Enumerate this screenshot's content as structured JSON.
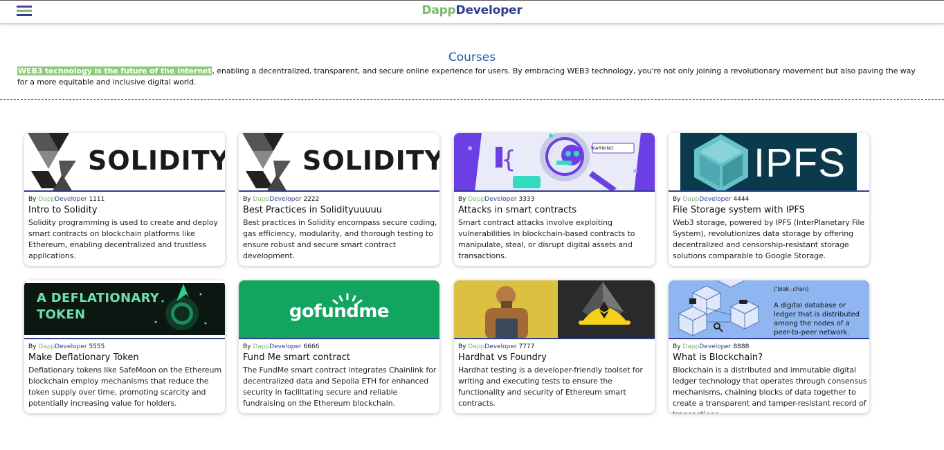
{
  "header": {
    "brand_part1": "Dapp",
    "brand_part2": "Developer",
    "menu_icon": "hamburger-menu-icon"
  },
  "main": {
    "title": "Courses",
    "intro_highlight": "WEB3 technology is the future of the internet",
    "intro_rest": ", enabling a decentralized, transparent, and secure online experience for users. By embracing WEB3 technology, you're not only joining a revolutionary movement but also paving the way for a more equitable and inclusive digital world."
  },
  "courses": [
    {
      "by": "By",
      "author1": "Dapp",
      "author2": "Developer",
      "id": "1111",
      "title": "Intro to Solidity",
      "description": "Solidity programming is used to create and deploy smart contracts on blockchain platforms like Ethereum, enabling decentralized and trustless applications.",
      "image_text": "SOLIDITY"
    },
    {
      "by": "By",
      "author1": "Dapp",
      "author2": "Developer",
      "id": "2222",
      "title": "Best Practices in Solidityuuuuu",
      "description": "Best practices in Solidity encompass secure coding, gas efficiency, modularity, and thorough testing to ensure robust and secure smart contract development.",
      "image_text": "SOLIDITY"
    },
    {
      "by": "By",
      "author1": "Dapp",
      "author2": "Developer",
      "id": "3333",
      "title": "Attacks in smart contracts",
      "description": "Smart contract attacks involve exploiting vulnerabilities in blockchain-based contracts to manipulate, steal, or disrupt digital assets and transactions.",
      "image_text": "WARNING"
    },
    {
      "by": "By",
      "author1": "Dapp",
      "author2": "Developer",
      "id": "4444",
      "title": "File Storage system with IPFS",
      "description": "Web3 storage, powered by IPFS (InterPlanetary File System), revolutionizes data storage by offering decentralized and censorship-resistant storage solutions comparable to Google Storage.",
      "image_text": "IPFS"
    },
    {
      "by": "By",
      "author1": "Dapp",
      "author2": "Developer",
      "id": "5555",
      "title": "Make Deflationary Token",
      "description": "Deflationary tokens like SafeMoon on the Ethereum blockchain employ mechanisms that reduce the token supply over time, promoting scarcity and potentially increasing value for holders.",
      "image_line1": "A DEFLATIONARY",
      "image_line2": "TOKEN"
    },
    {
      "by": "By",
      "author1": "Dapp",
      "author2": "Developer",
      "id": "6666",
      "title": "Fund Me smart contract",
      "description": "The FundMe smart contract integrates Chainlink for decentralized data and Sepolia ETH for enhanced security in facilitating secure and reliable fundraising on the Ethereum blockchain.",
      "image_text": "gofundme"
    },
    {
      "by": "By",
      "author1": "Dapp",
      "author2": "Developer",
      "id": "7777",
      "title": "Hardhat vs Foundry",
      "description": "Hardhat testing is a developer-friendly toolset for writing and executing tests to ensure the functionality and security of Ethereum smart contracts."
    },
    {
      "by": "By",
      "author1": "Dapp",
      "author2": "Developer",
      "id": "8888",
      "title": "What is Blockchain?",
      "description": "Blockchain is a distributed and immutable digital ledger technology that operates through consensus mechanisms, chaining blocks of data together to create a transparent and tamper-resistant record of transactions.",
      "image_phonetic": "['blak-,chan]",
      "image_definition": "A digital database or ledger that is distributed among the nodes of a peer-to-peer network."
    }
  ],
  "colors": {
    "brand_green": "#7bb86f",
    "brand_blue": "#2f3f8f",
    "title_blue": "#1f5aa8"
  }
}
